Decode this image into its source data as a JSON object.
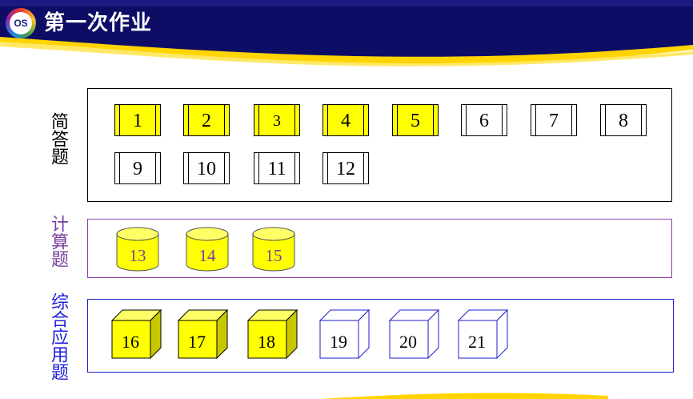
{
  "header": {
    "logo_text": "OS",
    "title": "第一次作业",
    "colors": {
      "navy": "#0d0d66",
      "yellow": "#ffd400"
    }
  },
  "sections": {
    "short_answer": {
      "label": "简答题",
      "items": [
        {
          "num": "1",
          "done": true
        },
        {
          "num": "2",
          "done": true
        },
        {
          "num": "3",
          "done": true
        },
        {
          "num": "4",
          "done": true
        },
        {
          "num": "5",
          "done": true
        },
        {
          "num": "6",
          "done": false
        },
        {
          "num": "7",
          "done": false
        },
        {
          "num": "8",
          "done": false
        },
        {
          "num": "9",
          "done": false
        },
        {
          "num": "10",
          "done": false
        },
        {
          "num": "11",
          "done": false
        },
        {
          "num": "12",
          "done": false
        }
      ]
    },
    "calculation": {
      "label": "计算题",
      "items": [
        {
          "num": "13",
          "done": true
        },
        {
          "num": "14",
          "done": true
        },
        {
          "num": "15",
          "done": true
        }
      ]
    },
    "comprehensive": {
      "label": "综合应用题",
      "items": [
        {
          "num": "16",
          "done": true
        },
        {
          "num": "17",
          "done": true
        },
        {
          "num": "18",
          "done": true
        },
        {
          "num": "19",
          "done": false
        },
        {
          "num": "20",
          "done": false
        },
        {
          "num": "21",
          "done": false
        }
      ]
    }
  },
  "colors": {
    "done_fill": "#ffff00",
    "done_side": "#c8c800",
    "calc_border": "#8e3fa8",
    "comp_border": "#1d1dcc"
  }
}
